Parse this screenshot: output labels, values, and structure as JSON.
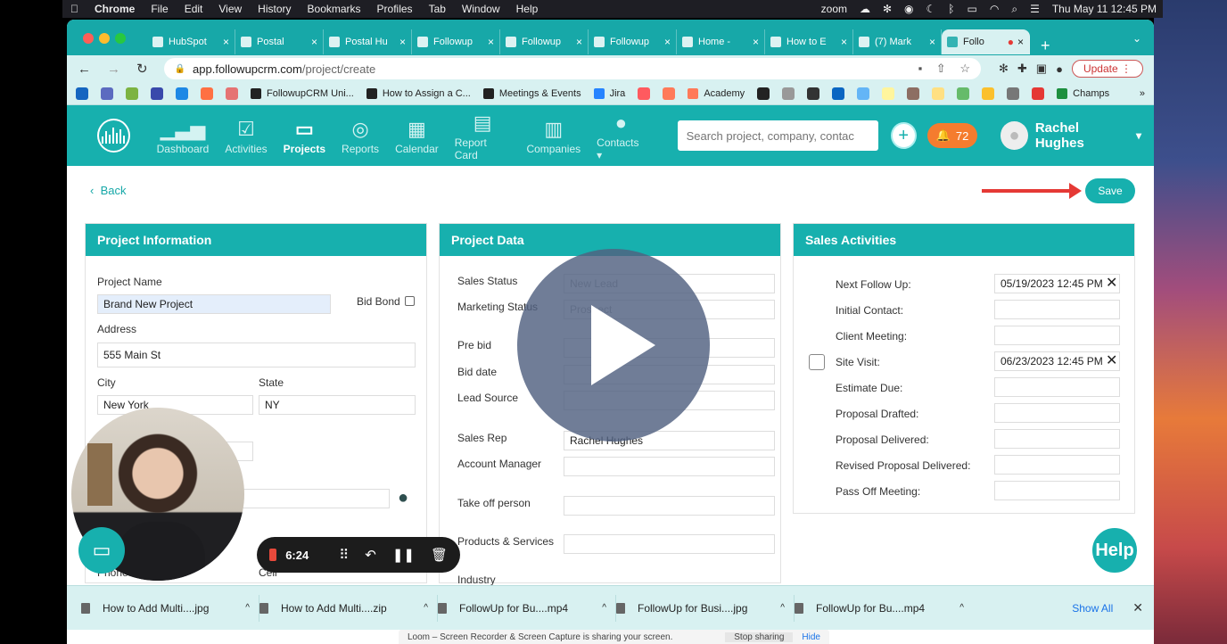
{
  "menubar": {
    "app": "Chrome",
    "items": [
      "File",
      "Edit",
      "View",
      "History",
      "Bookmarks",
      "Profiles",
      "Tab",
      "Window",
      "Help"
    ],
    "zoom": "zoom",
    "datetime": "Thu May 11  12:45 PM"
  },
  "tabs": [
    {
      "label": "HubSpot"
    },
    {
      "label": "Postal"
    },
    {
      "label": "Postal Hu"
    },
    {
      "label": "Followup"
    },
    {
      "label": "Followup"
    },
    {
      "label": "Followup"
    },
    {
      "label": "Home -"
    },
    {
      "label": "How to E"
    },
    {
      "label": "(7) Mark"
    },
    {
      "label": "Follo",
      "active": true
    }
  ],
  "address": {
    "url_host": "app.followupcrm.com",
    "url_path": "/project/create",
    "update_label": "Update"
  },
  "bookmarks": [
    {
      "label": "FollowupCRM Uni...",
      "color": "#222222"
    },
    {
      "label": "How to Assign a C...",
      "color": "#222222"
    },
    {
      "label": "Meetings & Events",
      "color": "#222222"
    },
    {
      "label": "Jira",
      "color": "#2684ff"
    },
    {
      "label": "Academy",
      "color": "#ff7a59"
    },
    {
      "label": "Champs",
      "color": "#1d8f3f"
    }
  ],
  "nav": {
    "items": [
      {
        "label": "Dashboard",
        "icon": "bar-chart-icon"
      },
      {
        "label": "Activities",
        "icon": "checklist-icon"
      },
      {
        "label": "Projects",
        "icon": "folder-icon",
        "active": true
      },
      {
        "label": "Reports",
        "icon": "target-icon"
      },
      {
        "label": "Calendar",
        "icon": "calendar-icon"
      },
      {
        "label": "Report Card",
        "icon": "document-icon"
      },
      {
        "label": "Companies",
        "icon": "building-icon"
      },
      {
        "label": "Contacts",
        "icon": "person-icon"
      }
    ],
    "search_placeholder": "Search project, company, contac",
    "notification_count": "72",
    "user_name": "Rachel Hughes"
  },
  "page": {
    "back_label": "Back",
    "save_label": "Save"
  },
  "project_info": {
    "title": "Project Information",
    "project_name_label": "Project Name",
    "project_name_value": "Brand New Project",
    "bid_bond_label": "Bid Bond",
    "address_label": "Address",
    "address_value": "555 Main St",
    "city_label": "City",
    "city_value": "New York",
    "state_label": "State",
    "state_value": "NY",
    "phone_label": "Phone",
    "cell_label": "Cell"
  },
  "project_data": {
    "title": "Project Data",
    "sales_status_label": "Sales Status",
    "sales_status_value": "New Lead",
    "marketing_status_label": "Marketing Status",
    "marketing_status_value": "Prospect",
    "pre_bid_label": "Pre bid",
    "bid_date_label": "Bid date",
    "lead_source_label": "Lead Source",
    "sales_rep_label": "Sales Rep",
    "sales_rep_value": "Rachel Hughes",
    "account_manager_label": "Account Manager",
    "take_off_label": "Take off person",
    "products_label": "Products & Services",
    "industry_label": "Industry"
  },
  "sales_activities": {
    "title": "Sales Activities",
    "rows": [
      {
        "label": "Next Follow Up:",
        "value": "05/19/2023 12:45 PM",
        "clear": true
      },
      {
        "label": "Initial Contact:",
        "value": ""
      },
      {
        "label": "Client Meeting:",
        "value": ""
      },
      {
        "label": "Site Visit:",
        "value": "06/23/2023 12:45 PM",
        "clear": true,
        "checkbox": true
      },
      {
        "label": "Estimate Due:",
        "value": ""
      },
      {
        "label": "Proposal Drafted:",
        "value": ""
      },
      {
        "label": "Proposal Delivered:",
        "value": ""
      },
      {
        "label": "Revised Proposal Delivered:",
        "value": ""
      },
      {
        "label": "Pass Off Meeting:",
        "value": ""
      }
    ]
  },
  "recorder": {
    "time": "6:24"
  },
  "help_label": "Help",
  "downloads": {
    "items": [
      "How to Add Multi....jpg",
      "How to Add Multi....zip",
      "FollowUp for Bu....mp4",
      "FollowUp for Busi....jpg",
      "FollowUp for Bu....mp4"
    ],
    "show_all": "Show All"
  },
  "loom": {
    "message": "Loom – Screen Recorder & Screen Capture is sharing your screen.",
    "stop_label": "Stop sharing",
    "hide_label": "Hide"
  },
  "colors": {
    "brand": "#17b0ae",
    "accent_orange": "#f57c2e",
    "arrow_red": "#e53935"
  }
}
